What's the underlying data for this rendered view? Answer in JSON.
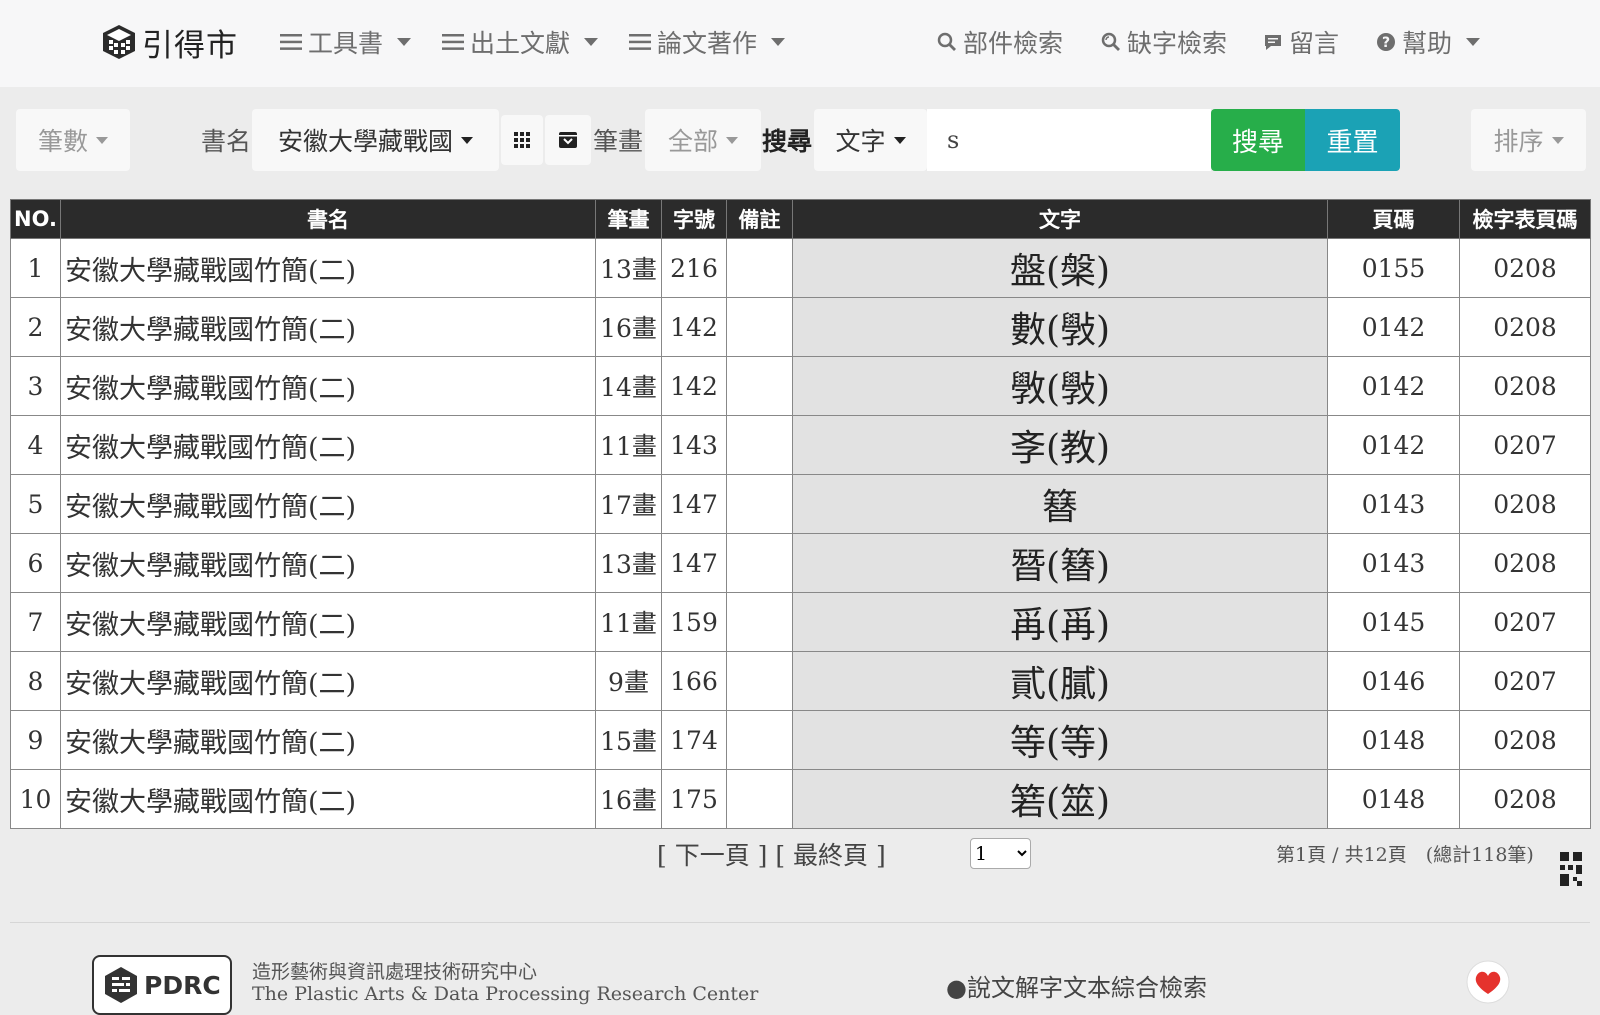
{
  "nav": {
    "brand": "引得市",
    "items": [
      {
        "label": "工具書"
      },
      {
        "label": "出土文獻"
      },
      {
        "label": "論文著作"
      }
    ],
    "right": [
      {
        "label": "部件檢索",
        "icon": "search-icon"
      },
      {
        "label": "缺字檢索",
        "icon": "search-alt-icon"
      },
      {
        "label": "留言",
        "icon": "comment-icon"
      },
      {
        "label": "幫助",
        "icon": "question-circle-icon"
      }
    ]
  },
  "filters": {
    "count_label": "筆數",
    "book_label": "書名",
    "book_value": "安徽大學藏戰國",
    "stroke_label": "筆畫",
    "stroke_value": "全部",
    "search_label": "搜尋",
    "search_type": "文字",
    "search_value": "s",
    "search_button": "搜尋",
    "reset_button": "重置",
    "sort_label": "排序"
  },
  "table": {
    "headers": [
      "NO.",
      "書名",
      "筆畫",
      "字號",
      "備註",
      "文字",
      "頁碼",
      "檢字表頁碼"
    ],
    "rows": [
      {
        "no": "1",
        "book": "安徽大學藏戰國竹簡(二)",
        "strokes": "13畫",
        "num": "216",
        "note": "",
        "char": "盤(槃)",
        "page": "0155",
        "index_page": "0208"
      },
      {
        "no": "2",
        "book": "安徽大學藏戰國竹簡(二)",
        "strokes": "16畫",
        "num": "142",
        "note": "",
        "char": "數(斅)",
        "page": "0142",
        "index_page": "0208"
      },
      {
        "no": "3",
        "book": "安徽大學藏戰國竹簡(二)",
        "strokes": "14畫",
        "num": "142",
        "note": "",
        "char": "斆(斅)",
        "page": "0142",
        "index_page": "0208"
      },
      {
        "no": "4",
        "book": "安徽大學藏戰國竹簡(二)",
        "strokes": "11畫",
        "num": "143",
        "note": "",
        "char": "斈(教)",
        "page": "0142",
        "index_page": "0207"
      },
      {
        "no": "5",
        "book": "安徽大學藏戰國竹簡(二)",
        "strokes": "17畫",
        "num": "147",
        "note": "",
        "char": "簮",
        "page": "0143",
        "index_page": "0208"
      },
      {
        "no": "6",
        "book": "安徽大學藏戰國竹簡(二)",
        "strokes": "13畫",
        "num": "147",
        "note": "",
        "char": "朁(簮)",
        "page": "0143",
        "index_page": "0208"
      },
      {
        "no": "7",
        "book": "安徽大學藏戰國竹簡(二)",
        "strokes": "11畫",
        "num": "159",
        "note": "",
        "char": "爯(爯)",
        "page": "0145",
        "index_page": "0207"
      },
      {
        "no": "8",
        "book": "安徽大學藏戰國竹簡(二)",
        "strokes": "9畫",
        "num": "166",
        "note": "",
        "char": "貳(膩)",
        "page": "0146",
        "index_page": "0207"
      },
      {
        "no": "9",
        "book": "安徽大學藏戰國竹簡(二)",
        "strokes": "15畫",
        "num": "174",
        "note": "",
        "char": "等(等)",
        "page": "0148",
        "index_page": "0208"
      },
      {
        "no": "10",
        "book": "安徽大學藏戰國竹簡(二)",
        "strokes": "16畫",
        "num": "175",
        "note": "",
        "char": "箬(筮)",
        "page": "0148",
        "index_page": "0208"
      }
    ]
  },
  "pagination": {
    "next": "[ 下一頁 ]",
    "last": "[ 最終頁 ]",
    "current": "1",
    "info": "第1頁 / 共12頁　(總計118筆)"
  },
  "footer": {
    "logo_text": "PDRC",
    "org_zh": "造形藝術與資訊處理技術研究中心",
    "org_en": "The Plastic Arts & Data Processing Research Center",
    "link": "●說文解字文本綜合檢索"
  },
  "colors": {
    "search_green": "#27ae4a",
    "reset_teal": "#1ba2b5",
    "header_dark": "#2b2b2b",
    "glyph_cell": "#e2e2e2"
  }
}
